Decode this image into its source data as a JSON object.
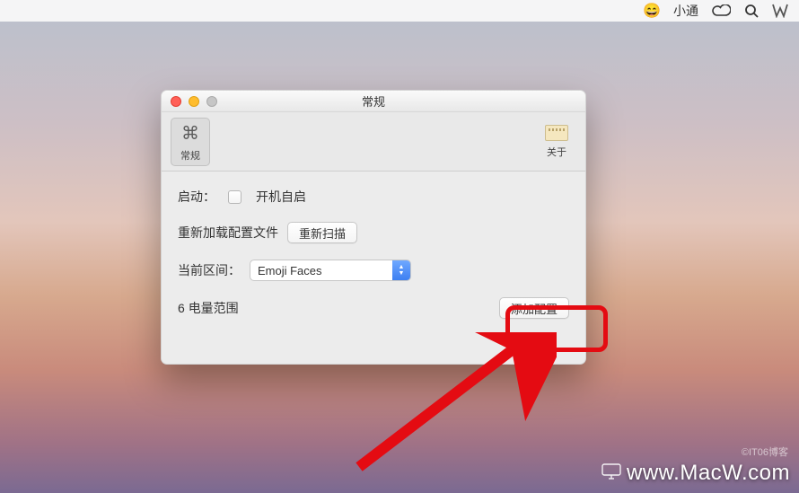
{
  "menubar": {
    "emoji": "😄",
    "user": "小通"
  },
  "window": {
    "title": "常规",
    "toolbar": {
      "general_icon": "⌘",
      "general_label": "常规",
      "about_label": "关于"
    },
    "content": {
      "launch_label": "启动：",
      "checkbox_label": "开机自启",
      "reload_label": "重新加载配置文件",
      "rescan_button": "重新扫描",
      "range_label": "当前区间：",
      "range_value": "Emoji Faces",
      "battery_count": "6",
      "battery_label": "电量范围",
      "add_button": "添加配置"
    }
  },
  "footer": {
    "attribution": "©IT06博客",
    "site": "www.MacW.com"
  }
}
